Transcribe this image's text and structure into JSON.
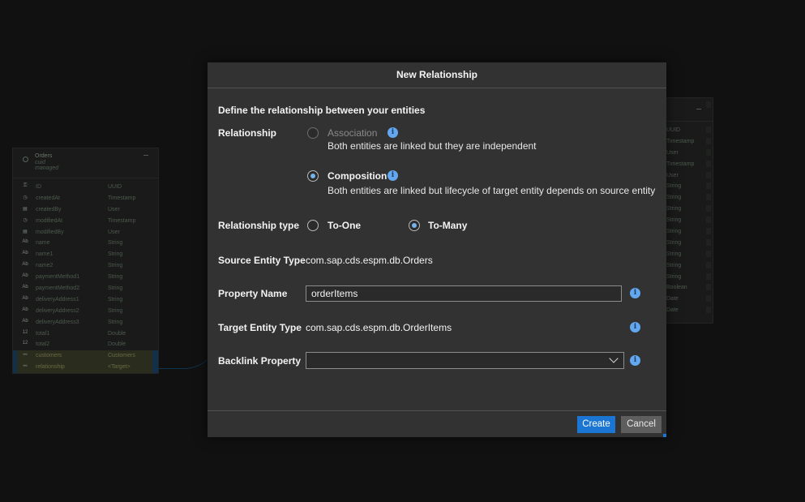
{
  "left_entity": {
    "name": "Orders",
    "sub1": "cuid",
    "sub2": "managed",
    "rows": [
      {
        "icon": "key-icon",
        "glyph": "⚿",
        "name": "ID",
        "type": "UUID"
      },
      {
        "icon": "clock-icon",
        "glyph": "◷",
        "name": "createdAt",
        "type": "Timestamp"
      },
      {
        "icon": "user-icon",
        "glyph": "▤",
        "name": "createdBy",
        "type": "User"
      },
      {
        "icon": "clock-icon",
        "glyph": "◷",
        "name": "modifiedAt",
        "type": "Timestamp"
      },
      {
        "icon": "user-icon",
        "glyph": "▤",
        "name": "modifiedBy",
        "type": "User"
      },
      {
        "icon": "text-icon",
        "glyph": "Ab",
        "name": "name",
        "type": "String"
      },
      {
        "icon": "text-icon",
        "glyph": "Ab",
        "name": "name1",
        "type": "String"
      },
      {
        "icon": "text-icon",
        "glyph": "Ab",
        "name": "name2",
        "type": "String"
      },
      {
        "icon": "text-icon",
        "glyph": "Ab",
        "name": "paymentMethod1",
        "type": "String"
      },
      {
        "icon": "text-icon",
        "glyph": "Ab",
        "name": "paymentMethod2",
        "type": "String"
      },
      {
        "icon": "text-icon",
        "glyph": "Ab",
        "name": "deliveryAddress1",
        "type": "String"
      },
      {
        "icon": "text-icon",
        "glyph": "Ab",
        "name": "deliveryAddress2",
        "type": "String"
      },
      {
        "icon": "text-icon",
        "glyph": "Ab",
        "name": "deliveryAddress3",
        "type": "String"
      },
      {
        "icon": "number-icon",
        "glyph": "12",
        "name": "total1",
        "type": "Double"
      },
      {
        "icon": "number-icon",
        "glyph": "12",
        "name": "total2",
        "type": "Double"
      },
      {
        "icon": "link-icon",
        "glyph": "⚯",
        "name": "customers",
        "type": "Customers"
      },
      {
        "icon": "link-icon",
        "glyph": "⚯",
        "name": "relationship",
        "type": "<Target>"
      }
    ]
  },
  "right_entity": {
    "rows": [
      "UUID",
      "Timestamp",
      "User",
      "Timestamp",
      "User",
      "String",
      "String",
      "String",
      "String",
      "String",
      "String",
      "String",
      "String",
      "String",
      "Boolean",
      "Date",
      "Date"
    ]
  },
  "dialog": {
    "title": "New Relationship",
    "intro": "Define the relationship between your entities",
    "relationship_label": "Relationship",
    "association": {
      "label": "Association",
      "description": "Both entities are linked but they are independent",
      "checked": false,
      "enabled": false
    },
    "composition": {
      "label": "Composition",
      "description": "Both entities are linked but lifecycle of target entity depends on source entity",
      "checked": true,
      "enabled": true
    },
    "relationship_type_label": "Relationship type",
    "to_one": {
      "label": "To-One",
      "checked": false
    },
    "to_many": {
      "label": "To-Many",
      "checked": true
    },
    "source_entity_label": "Source Entity Type",
    "source_entity_value": "com.sap.cds.espm.db.Orders",
    "property_name_label": "Property Name",
    "property_name_value": "orderItems",
    "target_entity_label": "Target Entity Type",
    "target_entity_value": "com.sap.cds.espm.db.OrderItems",
    "backlink_label": "Backlink Property",
    "backlink_value": "",
    "info_glyph": "i",
    "create_label": "Create",
    "cancel_label": "Cancel"
  },
  "colors": {
    "primary_button": "#1a76d2",
    "info_icon": "#63a7f0",
    "radio_dot": "#74b3ec"
  }
}
